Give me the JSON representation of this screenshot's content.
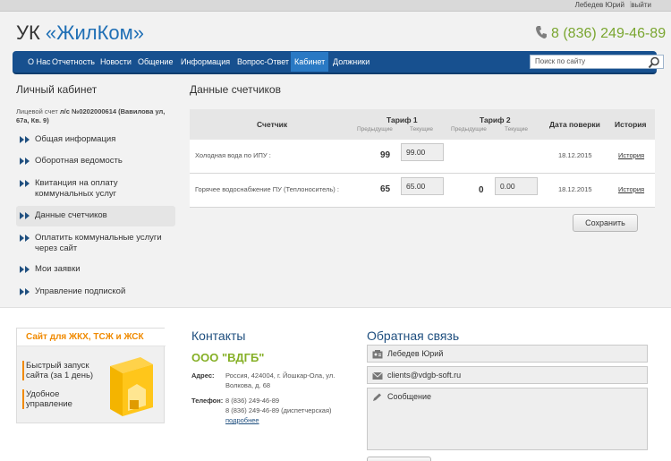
{
  "topbar": {
    "user_name": "Лебедев Юрий",
    "separator": "|",
    "logout": "выйти"
  },
  "header": {
    "logo_prefix": "УК ",
    "logo_brand": "«ЖилКом»",
    "phone": "8 (836) 249-46-89"
  },
  "nav": {
    "items": [
      "О Нас",
      "Отчетность",
      "Новости",
      "Общение",
      "Информация",
      "Вопрос-Ответ",
      "Кабинет",
      "Должники"
    ],
    "active": "Кабинет",
    "search_placeholder": "Поиск по сайту"
  },
  "sidebar": {
    "title": "Личный кабинет",
    "account_prefix": "Лицевой счет",
    "account_value": "л/с №0202000614 (Вавилова ул, 67а, Кв. 9)",
    "items": [
      {
        "label": "Общая информация"
      },
      {
        "label": "Оборотная ведомость"
      },
      {
        "label": "Квитанция на оплату коммунальных услуг"
      },
      {
        "label": "Данные счетчиков"
      },
      {
        "label": "Оплатить коммунальные услуги через сайт"
      },
      {
        "label": "Мои заявки"
      },
      {
        "label": "Управление подпиской"
      }
    ]
  },
  "main": {
    "title": "Данные счетчиков",
    "columns": {
      "meter": "Счетчик",
      "tariff1": "Тариф 1",
      "tariff2": "Тариф 2",
      "prev": "Предыдущие",
      "current": "Текущие",
      "check_date": "Дата поверки",
      "history": "История"
    },
    "rows": [
      {
        "name": "Холодная вода по ИПУ :",
        "t1_prev": "99",
        "t1_current": "99.00",
        "t2_prev": "",
        "t2_current": "",
        "date": "18.12.2015",
        "history": "История"
      },
      {
        "name": "Горячее водоснабжение ПУ (Теплоноситель) :",
        "t1_prev": "65",
        "t1_current": "65.00",
        "t2_prev": "0",
        "t2_current": "0.00",
        "date": "18.12.2015",
        "history": "История"
      }
    ],
    "save_label": "Сохранить"
  },
  "promo": {
    "title": "Сайт для ЖКХ, ТСЖ и ЖСК",
    "line1a": "Быстрый запуск",
    "line1b": "сайта (за 1 день)",
    "line2a": "Удобное",
    "line2b": "управление"
  },
  "contacts": {
    "title": "Контакты",
    "org": "ООО \"ВДГБ\"",
    "address_label": "Адрес:",
    "address_line1": "Россия, 424004, г. Йошкар-Ола, ул.",
    "address_line2": "Волкова, д. 68",
    "phone_label": "Телефон:",
    "phone1": "8 (836) 249-46-89",
    "phone2": "8 (836) 249-46-89 (диспетчерская)",
    "more": "подробнее"
  },
  "feedback": {
    "title": "Обратная связь",
    "name": "Лебедев Юрий",
    "email": "clients@vdgb-soft.ru",
    "message_placeholder": "Сообщение"
  },
  "colors": {
    "nav_bg": "#17508f",
    "brand_blue": "#1f6fb5",
    "accent_green": "#7aa630",
    "promo_orange": "#f08a00"
  }
}
